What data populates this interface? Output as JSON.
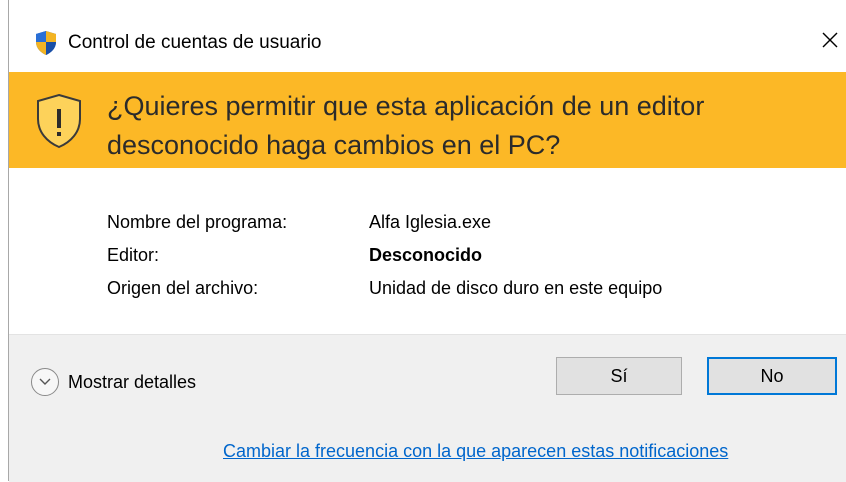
{
  "window": {
    "title": "Control de cuentas de usuario",
    "close_symbol": "✕"
  },
  "banner": {
    "question": "¿Quieres permitir que esta aplicación de un editor desconocido haga cambios en el PC?",
    "background_color": "#fcb826"
  },
  "info": {
    "program_label": "Nombre del programa:",
    "program_value": "Alfa Iglesia.exe",
    "publisher_label": "Editor:",
    "publisher_value": "Desconocido",
    "origin_label": "Origen del archivo:",
    "origin_value": "Unidad de disco duro en este equipo"
  },
  "footer": {
    "details_label": "Mostrar detalles",
    "yes_label": "Sí",
    "no_label": "No",
    "change_link": "Cambiar la frecuencia con la que aparecen estas notificaciones"
  },
  "icons": {
    "title_icon": "uac-shield-icon",
    "banner_icon": "warning-shield-icon",
    "details_icon": "chevron-down-icon",
    "close_icon": "close-icon"
  },
  "colors": {
    "accent": "#0078d7",
    "link": "#0066cc",
    "footer_bg": "#f0f0f0"
  }
}
